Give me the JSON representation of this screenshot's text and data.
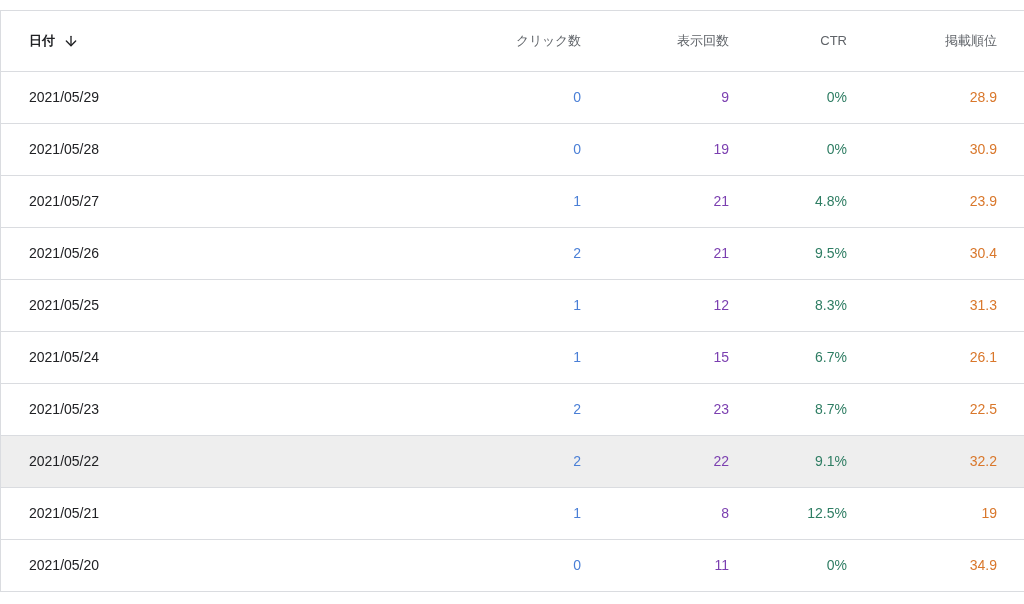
{
  "table": {
    "columns": [
      {
        "label": "日付",
        "sorted": true,
        "color": "#202124"
      },
      {
        "label": "クリック数",
        "sorted": false,
        "color": "#4a7fd6"
      },
      {
        "label": "表示回数",
        "sorted": false,
        "color": "#7b3fb0"
      },
      {
        "label": "CTR",
        "sorted": false,
        "color": "#2e7d63"
      },
      {
        "label": "掲載順位",
        "sorted": false,
        "color": "#d9772b"
      }
    ],
    "rows": [
      {
        "cells": [
          "2021/05/29",
          "0",
          "9",
          "0%",
          "28.9"
        ],
        "highlighted": false
      },
      {
        "cells": [
          "2021/05/28",
          "0",
          "19",
          "0%",
          "30.9"
        ],
        "highlighted": false
      },
      {
        "cells": [
          "2021/05/27",
          "1",
          "21",
          "4.8%",
          "23.9"
        ],
        "highlighted": false
      },
      {
        "cells": [
          "2021/05/26",
          "2",
          "21",
          "9.5%",
          "30.4"
        ],
        "highlighted": false
      },
      {
        "cells": [
          "2021/05/25",
          "1",
          "12",
          "8.3%",
          "31.3"
        ],
        "highlighted": false
      },
      {
        "cells": [
          "2021/05/24",
          "1",
          "15",
          "6.7%",
          "26.1"
        ],
        "highlighted": false
      },
      {
        "cells": [
          "2021/05/23",
          "2",
          "23",
          "8.7%",
          "22.5"
        ],
        "highlighted": false
      },
      {
        "cells": [
          "2021/05/22",
          "2",
          "22",
          "9.1%",
          "32.2"
        ],
        "highlighted": true
      },
      {
        "cells": [
          "2021/05/21",
          "1",
          "8",
          "12.5%",
          "19"
        ],
        "highlighted": false
      },
      {
        "cells": [
          "2021/05/20",
          "0",
          "11",
          "0%",
          "34.9"
        ],
        "highlighted": false
      }
    ]
  }
}
